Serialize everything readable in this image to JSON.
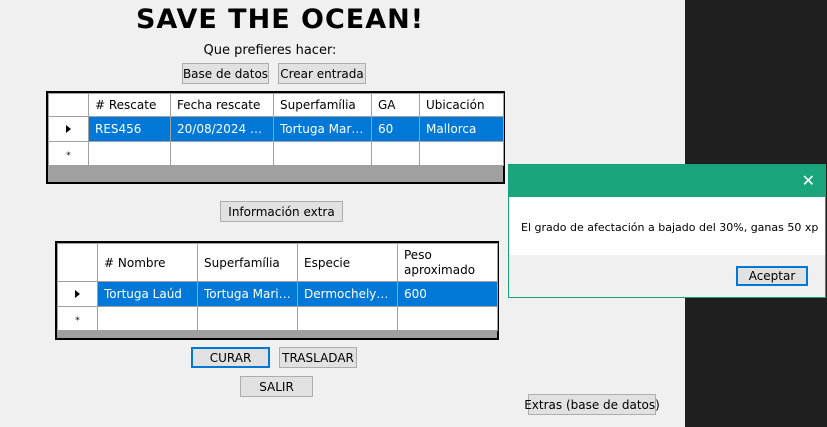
{
  "header": {
    "title": "SAVE THE OCEAN!",
    "subtitle": "Que prefieres hacer:"
  },
  "top_buttons": {
    "database": "Base de datos",
    "create": "Crear entrada"
  },
  "rescues_grid": {
    "columns": [
      "# Rescate",
      "Fecha rescate",
      "Superfamília",
      "GA",
      "Ubicación"
    ],
    "rows": [
      {
        "id": "RES456",
        "date": "20/08/2024 0:00:...",
        "superfamily": "Tortuga Marina",
        "ga": "60",
        "location": "Mallorca"
      }
    ],
    "new_row_marker": "*"
  },
  "extra_info_button": "Información extra",
  "patients_grid": {
    "columns": [
      "# Nombre",
      "Superfamília",
      "Especie",
      "Peso aproximado"
    ],
    "rows": [
      {
        "name": "Tortuga Laúd",
        "superfamily": "Tortuga Marina",
        "species": "Dermochelys c...",
        "weight": "600"
      }
    ],
    "new_row_marker": "*"
  },
  "actions": {
    "cure": "CURAR",
    "move": "TRASLADAR",
    "exit": "SALIR",
    "extras": "Extras (base de datos)"
  },
  "dialog": {
    "message": "El grado de afectación a bajado del 30%, ganas 50 xp",
    "ok": "Aceptar",
    "close_glyph": "✕",
    "accent": "#1aa57c"
  },
  "colors": {
    "selection": "#0078d7",
    "form_bg": "#f0f0f0"
  }
}
